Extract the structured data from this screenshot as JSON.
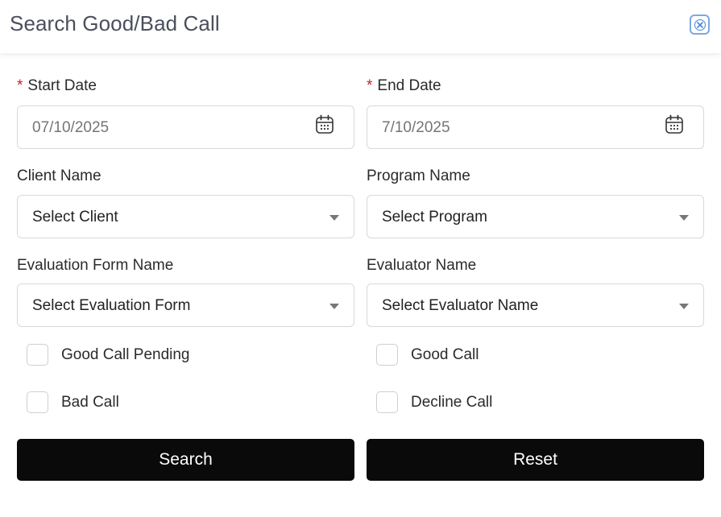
{
  "header": {
    "title": "Search Good/Bad Call",
    "close_icon": "close-icon"
  },
  "form": {
    "start_date": {
      "label": "Start Date",
      "required_mark": "*",
      "value": "07/10/2025",
      "icon": "calendar-icon"
    },
    "end_date": {
      "label": "End Date",
      "required_mark": "*",
      "value": "7/10/2025",
      "icon": "calendar-icon"
    },
    "client": {
      "label": "Client Name",
      "selected": "Select Client"
    },
    "program": {
      "label": "Program Name",
      "selected": "Select Program"
    },
    "evaluation_form": {
      "label": "Evaluation Form Name",
      "selected": "Select Evaluation Form"
    },
    "evaluator": {
      "label": "Evaluator Name",
      "selected": "Select Evaluator Name"
    },
    "checkboxes": {
      "good_call_pending": {
        "label": "Good Call Pending",
        "checked": false
      },
      "good_call": {
        "label": "Good Call",
        "checked": false
      },
      "bad_call": {
        "label": "Bad Call",
        "checked": false
      },
      "decline_call": {
        "label": "Decline Call",
        "checked": false
      }
    }
  },
  "actions": {
    "search_label": "Search",
    "reset_label": "Reset"
  },
  "colors": {
    "required": "#cc1f1f",
    "button_bg": "#0a0a0a",
    "close_accent": "#4a86d6"
  }
}
